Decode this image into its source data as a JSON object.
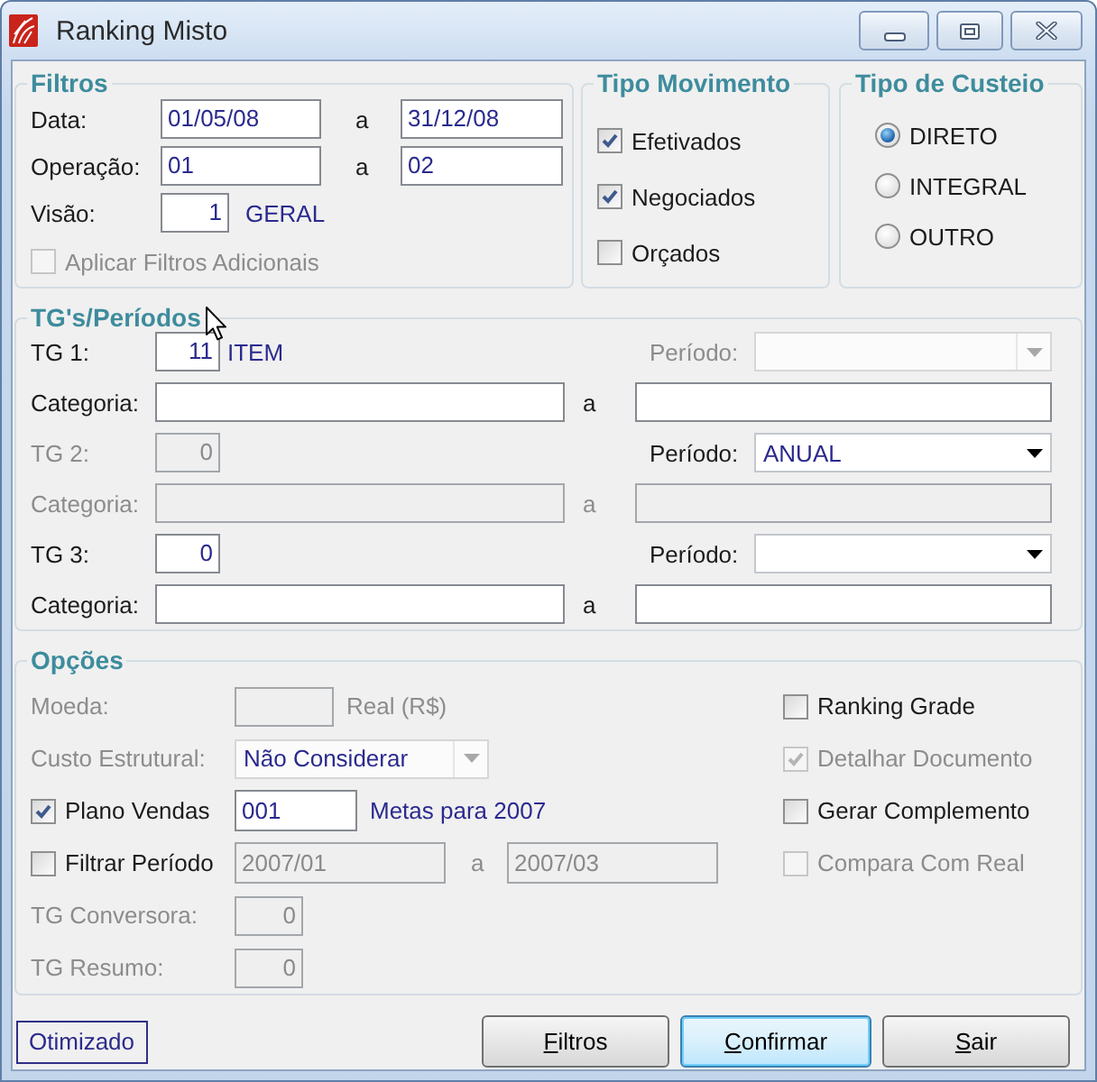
{
  "window": {
    "title": "Ranking Misto"
  },
  "filtros": {
    "title": "Filtros",
    "ranges": [
      {
        "label": "Data:",
        "from": "01/05/08",
        "separator": "a",
        "to": "31/12/08"
      },
      {
        "label": "Operação:",
        "from": "01",
        "separator": "a",
        "to": "02"
      }
    ],
    "visao": {
      "label": "Visão:",
      "value": "1",
      "description": "GERAL"
    },
    "aplicar": {
      "label": "Aplicar Filtros Adicionais",
      "checked": false,
      "disabled": true
    }
  },
  "tipo_movimento": {
    "title": "Tipo Movimento",
    "options": [
      {
        "label": "Efetivados",
        "checked": true
      },
      {
        "label": "Negociados",
        "checked": true
      },
      {
        "label": "Orçados",
        "checked": false
      }
    ]
  },
  "tipo_custeio": {
    "title": "Tipo de Custeio",
    "options": [
      {
        "label": "DIRETO",
        "selected": true
      },
      {
        "label": "INTEGRAL",
        "selected": false
      },
      {
        "label": "OUTRO",
        "selected": false
      }
    ]
  },
  "tgs": {
    "title": "TG's/Períodos",
    "items": [
      {
        "label": "TG 1:",
        "value": "11",
        "description": "ITEM",
        "disabled": false,
        "periodo": {
          "label": "Período:",
          "disabled": true
        },
        "categoria": {
          "label": "Categoria:",
          "separator": "a",
          "disabled": false
        }
      },
      {
        "label": "TG 2:",
        "value": "0",
        "disabled": true,
        "periodo": {
          "label": "Período:",
          "value": "ANUAL",
          "disabled": false
        },
        "categoria": {
          "label": "Categoria:",
          "separator": "a",
          "disabled": true
        }
      },
      {
        "label": "TG 3:",
        "value": "0",
        "disabled": false,
        "periodo": {
          "label": "Período:",
          "disabled": false
        },
        "categoria": {
          "label": "Categoria:",
          "separator": "a",
          "disabled": false
        }
      }
    ]
  },
  "opcoes": {
    "title": "Opções",
    "moeda": {
      "label": "Moeda:",
      "description": "Real (R$)",
      "disabled": true
    },
    "custo_estrutural": {
      "label": "Custo Estrutural:",
      "value": "Não Considerar",
      "disabled": true
    },
    "plano_vendas": {
      "label": "Plano Vendas",
      "checked": true,
      "value": "001",
      "description": "Metas para 2007"
    },
    "filtrar_periodo": {
      "label": "Filtrar Período",
      "checked": false,
      "from": "2007/01",
      "separator": "a",
      "to": "2007/03",
      "disabled": true
    },
    "tg_conversora": {
      "label": "TG Conversora:",
      "value": "0",
      "disabled": true
    },
    "tg_resumo": {
      "label": "TG Resumo:",
      "value": "0",
      "disabled": true
    },
    "flags": [
      {
        "label": "Ranking Grade",
        "checked": false,
        "disabled": false
      },
      {
        "label": "Detalhar Documento",
        "checked": true,
        "disabled": true
      },
      {
        "label": "Gerar Complemento",
        "checked": false,
        "disabled": false
      },
      {
        "label": "Compara Com Real",
        "checked": false,
        "disabled": true
      }
    ]
  },
  "status": {
    "label": "Otimizado"
  },
  "buttons": [
    {
      "label": "Filtros",
      "mnemonic": true,
      "focused": false
    },
    {
      "label": "Confirmar",
      "mnemonic": true,
      "focused": true
    },
    {
      "label": "Sair",
      "mnemonic": true,
      "focused": false
    }
  ]
}
